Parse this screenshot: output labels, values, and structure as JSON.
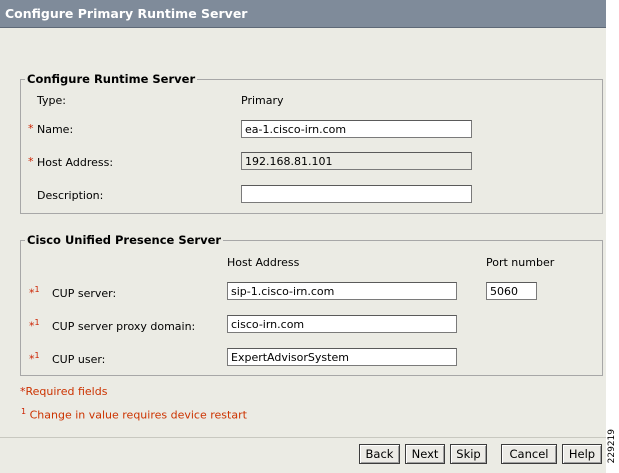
{
  "window": {
    "title": "Configure Primary Runtime Server"
  },
  "runtime_group": {
    "legend": "Configure Runtime Server",
    "type_label": "Type:",
    "type_value": "Primary",
    "name_label": "Name:",
    "name_value": "ea-1.cisco-irn.com",
    "host_label": "Host Address:",
    "host_value": "192.168.81.101",
    "description_label": "Description:",
    "description_value": ""
  },
  "cup_group": {
    "legend": "Cisco Unified Presence Server",
    "host_header": "Host Address",
    "port_header": "Port number",
    "server_label": "CUP server:",
    "server_value": "sip-1.cisco-irn.com",
    "port_value": "5060",
    "proxy_label": "CUP server proxy domain:",
    "proxy_value": "cisco-irn.com",
    "user_label": "CUP user:",
    "user_value": "ExpertAdvisorSystem"
  },
  "markers": {
    "asterisk": "*",
    "restart": "1"
  },
  "notes": {
    "required": "Required fields",
    "restart": "Change in value requires device restart"
  },
  "buttons": {
    "back": "Back",
    "next": "Next",
    "skip": "Skip",
    "cancel": "Cancel",
    "help": "Help"
  },
  "side_id": "229219",
  "colors": {
    "titlebar": "#7f8b9a",
    "panel": "#ebebe4",
    "required": "#cc2200"
  }
}
